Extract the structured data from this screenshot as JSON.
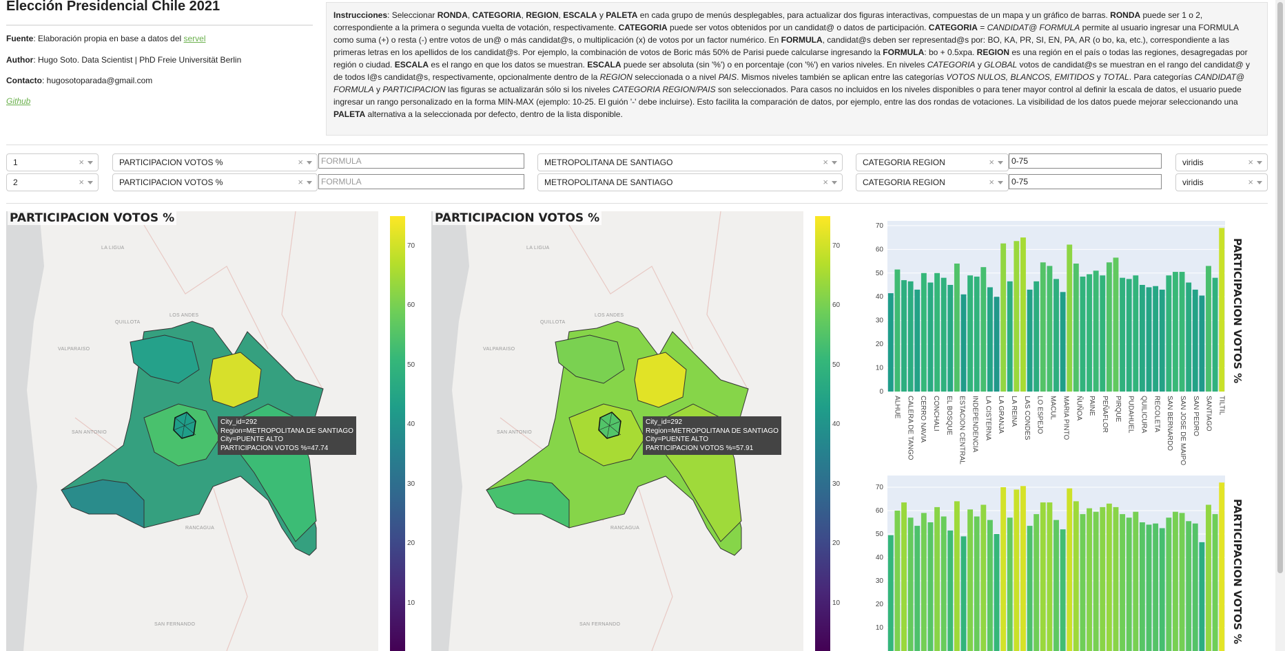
{
  "header": {
    "title": "Elección Presidencial Chile 2021",
    "fuente_label": "Fuente",
    "fuente_text": ": Elaboración propia en base a datos del ",
    "fuente_link": "servel",
    "author_label": "Author",
    "author_text": ": Hugo Soto. Data Scientist | PhD Freie Universität Berlin",
    "contact_label": "Contacto",
    "contact_text": ": hugosotoparada@gmail.com",
    "github_link": "Github"
  },
  "instructions": {
    "html": "<b>Instrucciones</b>: Seleccionar <b>RONDA</b>, <b>CATEGORIA</b>, <b>REGION</b>, <b>ESCALA</b> y <b>PALETA</b> en cada grupo de menús desplegables, para actualizar dos figuras interactivas, compuestas de un mapa y un gráfico de barras. <b>RONDA</b> puede ser 1 o 2, correspondiente a la primera o segunda vuelta de votación, respectivamente. <b>CATEGORIA</b> puede ser votos obtenidos por un candidat@ o datos de participación. <b>CATEGORIA</b> = <i>CANDIDAT@ FORMULA</i> permite al usuario ingresar una FORMULA como suma (+) o resta (-) entre votos de un@ o más candidat@s, o multiplicación (x) de votos por un factor numérico. En <b>FORMULA</b>, candidat@s deben ser representad@s por: BO, KA, PR, SI, EN, PA, AR (o bo, ka, etc.), correspondiente a las primeras letras en los apellidos de los candidat@s. Por ejemplo, la combinación de votos de Boric más 50% de Parisi puede calcularse ingresando la <b>FORMULA</b>: bo + 0.5xpa. <b>REGION</b> es una región en el país o todas las regiones, desagregadas por región o ciudad. <b>ESCALA</b> es el rango en que los datos se muestran. <b>ESCALA</b> puede ser absoluta (sin '%') o en porcentaje (con '%') en varios niveles. En niveles <i>CATEGORIA</i> y <i>GLOBAL</i> votos de candidat@s se muestran en el rango del candidat@ y de todos l@s candidat@s, respectivamente, opcionalmente dentro de la <i>REGION</i> seleccionada o a nivel <i>PAIS</i>. Mismos niveles también se aplican entre las categorías <i>VOTOS NULOS, BLANCOS, EMITIDOS</i> y <i>TOTAL</i>. Para categorías <i>CANDIDAT@ FORMULA</i> y <i>PARTICIPACION</i> las figuras se actualizarán sólo si los niveles <i>CATEGORIA REGION/PAIS</i> son seleccionados. Para casos no incluidos en los niveles disponibles o para tener mayor control al definir la escala de datos, el usuario puede ingresar un rango personalizado en la forma MIN-MAX (ejemplo: 10-25. El guión '-' debe incluirse). Esto facilita la comparación de datos, por ejemplo, entre las dos rondas de votaciones. La visibilidad de los datos puede mejorar seleccionando una <b>PALETA</b> alternativa a la seleccionada por defecto, dentro de la lista disponible."
  },
  "controls": [
    {
      "ronda": "1",
      "categoria": "PARTICIPACION VOTOS %",
      "formula_placeholder": "FORMULA",
      "region": "METROPOLITANA DE SANTIAGO",
      "escala": "CATEGORIA REGION",
      "rango": "0-75",
      "paleta": "viridis"
    },
    {
      "ronda": "2",
      "categoria": "PARTICIPACION VOTOS %",
      "formula_placeholder": "FORMULA",
      "region": "METROPOLITANA DE SANTIAGO",
      "escala": "CATEGORIA REGION",
      "rango": "0-75",
      "paleta": "viridis"
    }
  ],
  "icons": {
    "clear": "clear-x-icon",
    "dropdown": "chevron-down-icon"
  },
  "maps": [
    {
      "title": "PARTICIPACION VOTOS %",
      "tooltip": "City_id=292\nRegion=METROPOLITANA DE SANTIAGO\nCity=PUENTE ALTO\nPARTICIPACION VOTOS %=47.74"
    },
    {
      "title": "PARTICIPACION VOTOS %",
      "tooltip": "City_id=292\nRegion=METROPOLITANA DE SANTIAGO\nCity=PUENTE ALTO\nPARTICIPACION VOTOS %=57.91"
    }
  ],
  "map_places": [
    "LA LIGUA",
    "LOS ANDES",
    "QUILLOTA",
    "VALPARAISO",
    "SAN ANTONIO",
    "RANCAGUA",
    "SAN FERNANDO"
  ],
  "colorbar_ticks": [
    "70",
    "60",
    "50",
    "40",
    "30",
    "20",
    "10"
  ],
  "colors": {
    "viridis_high": "#fde725",
    "viridis_mid": "#21918c",
    "viridis_low": "#440154",
    "link": "#6ab04c",
    "chart_bg": "#e5ecf6"
  },
  "chart_data": [
    {
      "type": "bar",
      "title": "",
      "ylabel": "PARTICIPACION VOTOS %",
      "ylim": [
        0,
        72
      ],
      "yticks": [
        0,
        10,
        20,
        30,
        40,
        50,
        60,
        70
      ],
      "categories": [
        "ALHUE",
        "CALERA DE TANGO",
        "CERRO NAVIA",
        "CONCHALI",
        "EL BOSQUE",
        "ESTACION CENTRAL",
        "INDEPENDENCIA",
        "LA CISTERNA",
        "LA GRANJA",
        "LA REINA",
        "LAS CONDES",
        "LO ESPEJO",
        "MACUL",
        "MARIA PINTO",
        "ÑUÑOA",
        "PAINE",
        "PEÑAFLOR",
        "PIRQUE",
        "PUDAHUEL",
        "QUILICURA",
        "RECOLETA",
        "SAN BERNARDO",
        "SAN JOSE DE MAIPO",
        "SAN PEDRO",
        "SANTIAGO",
        "TILTIL"
      ],
      "values": [
        41.5,
        51.5,
        47,
        46.5,
        43,
        50,
        46,
        50,
        48,
        45,
        54,
        41,
        49,
        48.5,
        52.5,
        44,
        40,
        62.5,
        46.5,
        63.5,
        65,
        43,
        46.5,
        54.5,
        53,
        47.5,
        42,
        62,
        54,
        48.5,
        49.5,
        51,
        49,
        54.5,
        56.5,
        48,
        47.5,
        49,
        45,
        44,
        44.5,
        43,
        49,
        50.5,
        50.5,
        46,
        43,
        40.5,
        53,
        48,
        69
      ]
    },
    {
      "type": "bar",
      "title": "",
      "ylabel": "PARTICIPACION VOTOS %",
      "ylim": [
        0,
        75
      ],
      "yticks": [
        10,
        20,
        30,
        40,
        50,
        60,
        70
      ],
      "categories": [],
      "values": [
        49.5,
        60,
        63.5,
        57,
        53.5,
        59,
        55,
        61.5,
        57.5,
        51.5,
        64,
        49,
        60.5,
        57.5,
        62.5,
        56,
        50,
        70,
        57,
        69,
        70.5,
        53.5,
        58.5,
        63.5,
        63.5,
        56,
        52,
        69.5,
        64,
        58.5,
        61,
        59.5,
        61.5,
        63,
        61.5,
        58.5,
        57,
        59.5,
        55,
        54,
        54.5,
        52.5,
        57,
        59.5,
        59,
        55.5,
        54.5,
        46.5,
        62.5,
        58.5,
        72
      ]
    }
  ]
}
